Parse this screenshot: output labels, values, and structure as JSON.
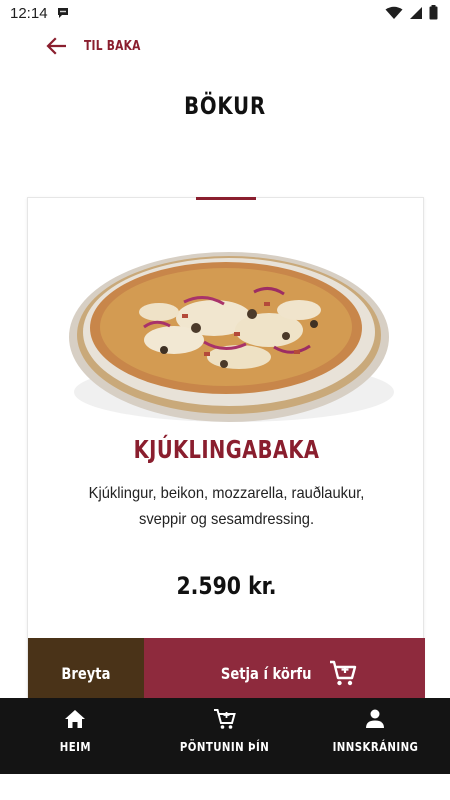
{
  "status_bar": {
    "time": "12:14"
  },
  "header": {
    "back_label": "TIL BAKA",
    "title": "BÖKUR"
  },
  "product": {
    "name": "KJÚKLINGABAKA",
    "description": "Kjúklingur, beikon, mozzarella, rauðlaukur, sveppir og sesamdressing.",
    "price": "2.590 kr.",
    "edit_label": "Breyta",
    "add_to_cart_label": "Setja í körfu"
  },
  "bottom_nav": {
    "items": [
      {
        "label": "HEIM",
        "icon": "home-icon"
      },
      {
        "label": "PÖNTUNIN ÞÍN",
        "icon": "cart-icon"
      },
      {
        "label": "INNSKRÁNING",
        "icon": "person-icon"
      }
    ]
  },
  "colors": {
    "brand_red": "#8a1e2e",
    "cart_button": "#8e2a3d",
    "edit_button": "#4a3318",
    "nav_background": "#141414"
  }
}
